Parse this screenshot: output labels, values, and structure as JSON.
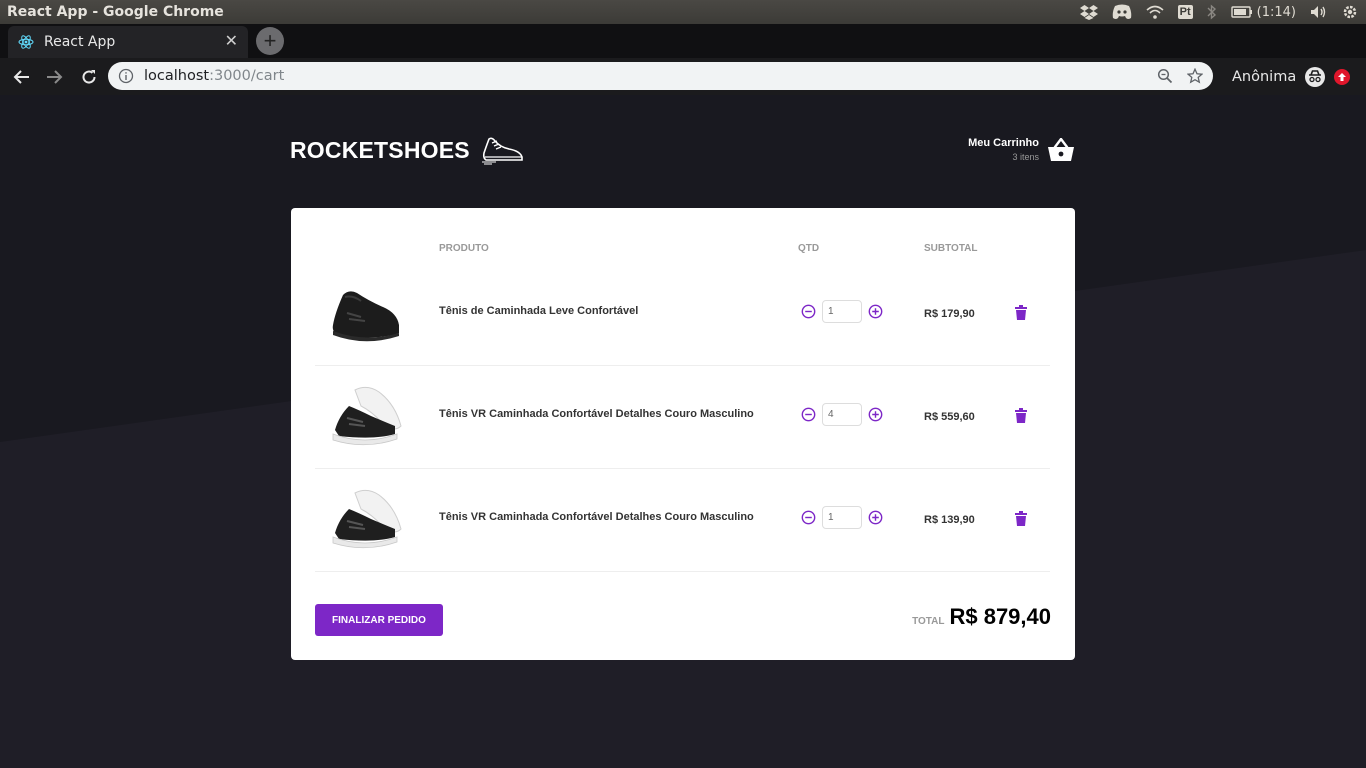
{
  "os": {
    "window_title": "React App - Google Chrome",
    "tray_pt": "Pt",
    "clock": "(1:14)"
  },
  "browser": {
    "tab_title": "React App",
    "tab_close": "✕",
    "new_tab": "+",
    "url_host": "localhost",
    "url_rest": ":3000/cart",
    "profile_name": "Anônima"
  },
  "header": {
    "logo_text": "ROCKETSHOES",
    "cart_title": "Meu Carrinho",
    "cart_count": "3 itens"
  },
  "table": {
    "col_product": "PRODUTO",
    "col_qty": "QTD",
    "col_subtotal": "SUBTOTAL"
  },
  "items": [
    {
      "title": "Tênis de Caminhada Leve Confortável",
      "qty": "1",
      "subtotal": "R$ 179,90",
      "image": "black-sneaker"
    },
    {
      "title": "Tênis VR Caminhada Confortável Detalhes Couro Masculino",
      "qty": "4",
      "subtotal": "R$ 559,60",
      "image": "black-white-sneaker"
    },
    {
      "title": "Tênis VR Caminhada Confortável Detalhes Couro Masculino",
      "qty": "1",
      "subtotal": "R$ 139,90",
      "image": "black-white-sneaker"
    }
  ],
  "footer": {
    "finish_label": "FINALIZAR PEDIDO",
    "total_label": "TOTAL",
    "total_value": "R$ 879,40"
  },
  "colors": {
    "accent": "#7d27c7",
    "page_bg": "#191920",
    "page_bg_light": "#1f1e27"
  }
}
